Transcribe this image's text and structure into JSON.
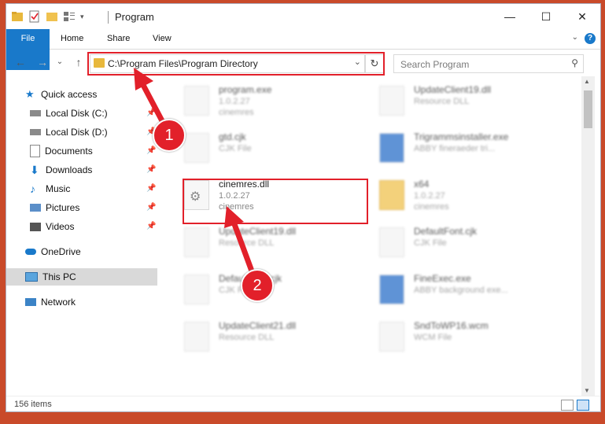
{
  "window": {
    "title": "Program",
    "controls": {
      "minimize": "—",
      "maximize": "☐",
      "close": "✕"
    }
  },
  "ribbon": {
    "tabs": [
      "File",
      "Home",
      "Share",
      "View"
    ],
    "help": "?",
    "expand": "⌄"
  },
  "nav": {
    "back": "←",
    "forward": "→",
    "recent": "⌄",
    "up": "↑",
    "address": "C:\\Program Files\\Program Directory",
    "address_dropdown": "⌄",
    "refresh": "↻",
    "search_placeholder": "Search Program",
    "search_icon": "⚲"
  },
  "sidebar": {
    "items": [
      {
        "label": "Quick access",
        "icon": "star-icon",
        "pinned": false
      },
      {
        "label": "Local Disk (C:)",
        "icon": "drive-icon",
        "pinned": true
      },
      {
        "label": "Local Disk (D:)",
        "icon": "drive-icon",
        "pinned": true
      },
      {
        "label": "Documents",
        "icon": "documents-icon",
        "pinned": true
      },
      {
        "label": "Downloads",
        "icon": "downloads-icon",
        "pinned": true
      },
      {
        "label": "Music",
        "icon": "music-icon",
        "pinned": true
      },
      {
        "label": "Pictures",
        "icon": "pictures-icon",
        "pinned": true
      },
      {
        "label": "Videos",
        "icon": "videos-icon",
        "pinned": true
      },
      {
        "label": "OneDrive",
        "icon": "onedrive-icon",
        "pinned": false
      },
      {
        "label": "This PC",
        "icon": "this-pc-icon",
        "pinned": false,
        "selected": true
      },
      {
        "label": "Network",
        "icon": "network-icon",
        "pinned": false
      }
    ],
    "pin_glyph": "📌"
  },
  "files": [
    {
      "name": "program.exe",
      "line2": "1.0.2.27",
      "line3": "cinemres",
      "focus": false
    },
    {
      "name": "UpdateClient19.dll",
      "line2": "Resource DLL",
      "line3": "",
      "focus": false
    },
    {
      "name": "gtd.cjk",
      "line2": "CJK File",
      "line3": "",
      "focus": false
    },
    {
      "name": "Trigrammsinstaller.exe",
      "line2": "ABBY fineraeder tri...",
      "line3": "",
      "focus": false
    },
    {
      "name": "cinemres.dll",
      "line2": "1.0.2.27",
      "line3": "cinemres",
      "focus": true
    },
    {
      "name": "x64",
      "line2": "1.0.2.27",
      "line3": "cinemres",
      "focus": false
    },
    {
      "name": "UpdateClient19.dll",
      "line2": "Resource DLL",
      "line3": "",
      "focus": false
    },
    {
      "name": "DefaultFont.cjk",
      "line2": "CJK File",
      "line3": "",
      "focus": false
    },
    {
      "name": "DefaultFont.cjk",
      "line2": "CJK File",
      "line3": "",
      "focus": false
    },
    {
      "name": "FineExec.exe",
      "line2": "ABBY background exe...",
      "line3": "",
      "focus": false
    },
    {
      "name": "UpdateClient21.dll",
      "line2": "Resource DLL",
      "line3": "",
      "focus": false
    },
    {
      "name": "SndToWP16.wcm",
      "line2": "WCM File",
      "line3": "",
      "focus": false
    }
  ],
  "status": {
    "count": "156 items"
  },
  "annotations": {
    "step1": "1",
    "step2": "2"
  },
  "colors": {
    "accent": "#1979ca",
    "highlight": "#e2202a"
  }
}
